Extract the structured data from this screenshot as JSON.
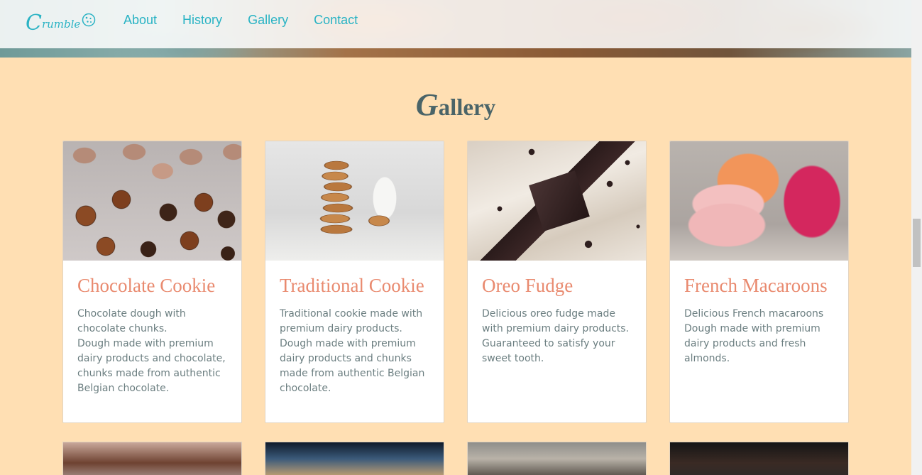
{
  "brand": {
    "logo_cap": "C",
    "logo_rest": "rumble"
  },
  "nav": {
    "items": [
      "About",
      "History",
      "Gallery",
      "Contact"
    ]
  },
  "section": {
    "title_cap": "G",
    "title_rest": "allery"
  },
  "cards": [
    {
      "title": "Chocolate Cookie",
      "desc": "Chocolate dough with chocolate chunks.\nDough made with premium dairy products and chocolate, chunks made from authentic Belgian chocolate."
    },
    {
      "title": "Traditional Cookie",
      "desc": "Traditional cookie made with premium dairy products.\nDough made with premium dairy products and chunks made from authentic Belgian chocolate."
    },
    {
      "title": "Oreo Fudge",
      "desc": "Delicious oreo fudge made with premium dairy products. Guaranteed to satisfy your sweet tooth."
    },
    {
      "title": "French Macaroons",
      "desc": "Delicious French macaroons Dough made with premium dairy products and fresh almonds."
    }
  ],
  "colors": {
    "background": "#ffdfb3",
    "accent": "#29b3c4",
    "card_title": "#e98a6f",
    "text": "#6b7e80"
  }
}
